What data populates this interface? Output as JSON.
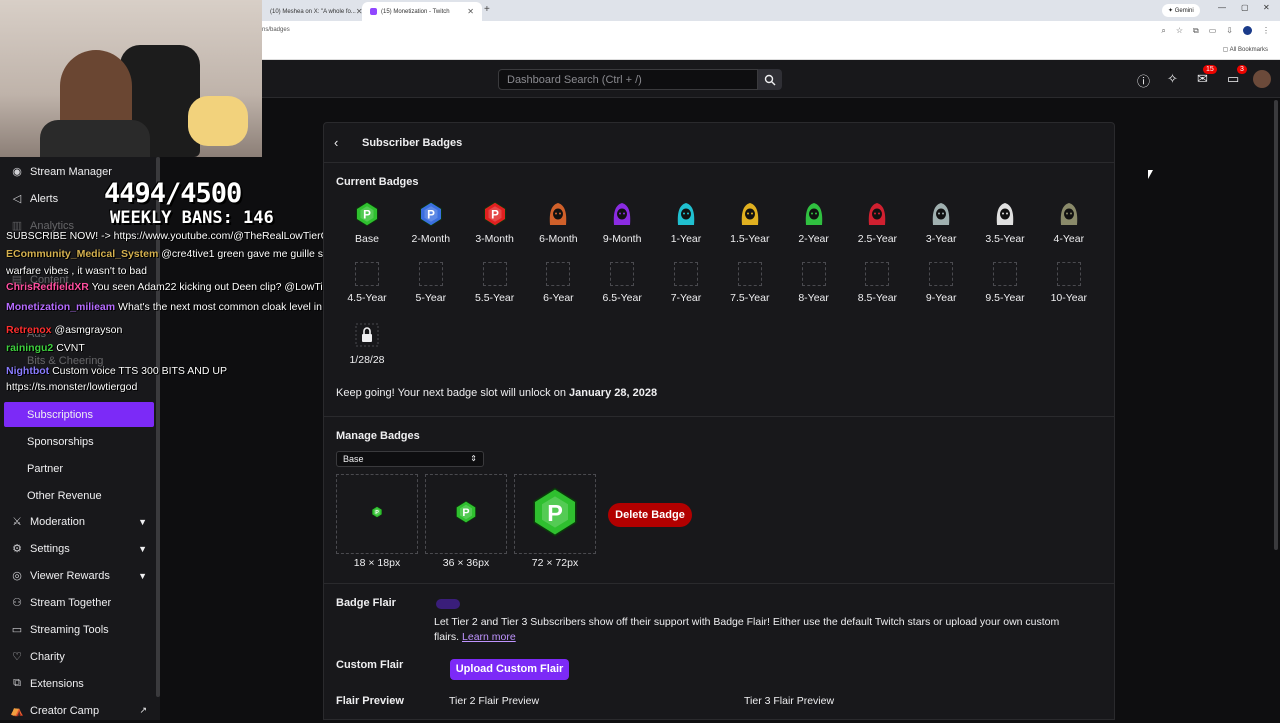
{
  "browser": {
    "tabs": [
      {
        "title": "(10) Meshea on X: \"A whole fo...",
        "active": false
      },
      {
        "title": "(15) Monetization - Twitch",
        "active": true
      }
    ],
    "url": "ns/badges",
    "gemini_label": "Gemini",
    "bookmarks_label": "All Bookmarks"
  },
  "topnav": {
    "search_placeholder": "Dashboard Search (Ctrl + /)",
    "notifications_count": "15",
    "whispers_count": "3"
  },
  "overlay": {
    "count": "4494/4500",
    "weekly_bans": "WEEKLY BANS: 146"
  },
  "chat": [
    {
      "user": "",
      "text": "SUBSCRIBE NOW! -> https://www.youtube.com/@TheRealLowTierGod"
    },
    {
      "user": "ECommunity_Medical_System",
      "text": "@cre4tive1 green gave me guille suit modern"
    },
    {
      "user": "",
      "text": "warfare vibes , it wasn't to bad"
    },
    {
      "user": "ChrisRedfieldXR",
      "text": "You seen Adam22 kicking out Deen clip? @LowTierGod"
    },
    {
      "user": "Monetization_milieam",
      "text": "What's the next most common cloak level in chat?"
    },
    {
      "user": "Retrenox",
      "text": "@asmgrayson"
    },
    {
      "user": "rainingu2",
      "text": "CVNT"
    },
    {
      "user": "Nightbot",
      "text": "Custom voice TTS 300 BITS AND UP"
    },
    {
      "user": "",
      "text": "https://ts.monster/lowtiergod"
    }
  ],
  "sidebar": {
    "items": [
      {
        "label": "Stream Manager",
        "icon": "stream-manager-icon"
      },
      {
        "label": "Alerts",
        "icon": "megaphone-icon"
      },
      {
        "label": "Analytics",
        "icon": "chart-icon"
      },
      {
        "label": "Content",
        "icon": "content-icon"
      },
      {
        "label": "Ads",
        "icon": "ads-icon"
      },
      {
        "label": "Bits & Cheering",
        "icon": "bits-icon"
      },
      {
        "label": "Subscriptions",
        "icon": ""
      },
      {
        "label": "Sponsorships",
        "icon": ""
      },
      {
        "label": "Partner",
        "icon": ""
      },
      {
        "label": "Other Revenue",
        "icon": ""
      },
      {
        "label": "Moderation",
        "icon": "sword-icon"
      },
      {
        "label": "Settings",
        "icon": "gear-icon"
      },
      {
        "label": "Viewer Rewards",
        "icon": "rewards-icon"
      },
      {
        "label": "Stream Together",
        "icon": "people-icon"
      },
      {
        "label": "Streaming Tools",
        "icon": "tools-icon"
      },
      {
        "label": "Charity",
        "icon": "charity-icon"
      },
      {
        "label": "Extensions",
        "icon": "puzzle-icon"
      },
      {
        "label": "Creator Camp",
        "icon": "creator-camp-icon"
      }
    ]
  },
  "panel": {
    "title": "Subscriber Badges",
    "current_badges_title": "Current Badges",
    "badges_row1": [
      "Base",
      "2-Month",
      "3-Month",
      "6-Month",
      "9-Month",
      "1-Year",
      "1.5-Year",
      "2-Year",
      "2.5-Year",
      "3-Year",
      "3.5-Year",
      "4-Year"
    ],
    "badges_row2": [
      "4.5-Year",
      "5-Year",
      "5.5-Year",
      "6-Year",
      "6.5-Year",
      "7-Year",
      "7.5-Year",
      "8-Year",
      "8.5-Year",
      "9-Year",
      "9.5-Year",
      "10-Year"
    ],
    "locked_badge_date": "1/28/28",
    "info_prefix": "Keep going! Your next badge slot will unlock on ",
    "info_date": "January 28, 2028",
    "manage_title": "Manage Badges",
    "manage_select": "Base",
    "sizes": [
      "18 × 18px",
      "36 × 36px",
      "72 × 72px"
    ],
    "delete_label": "Delete Badge",
    "badge_flair_title": "Badge Flair",
    "badge_flair_text": "Let Tier 2 and Tier 3 Subscribers show off their support with Badge Flair! Either use the default Twitch stars or upload your own custom flairs.",
    "learn_more": "Learn more",
    "custom_flair_title": "Custom Flair",
    "upload_label": "Upload Custom Flair",
    "flair_preview_title": "Flair Preview",
    "tier2_preview": "Tier 2 Flair Preview",
    "tier3_preview": "Tier 3 Flair Preview"
  },
  "colors": {
    "accent": "#7c2af7",
    "danger": "#b20000",
    "background": "#0e0e10",
    "panel": "#18181b"
  }
}
